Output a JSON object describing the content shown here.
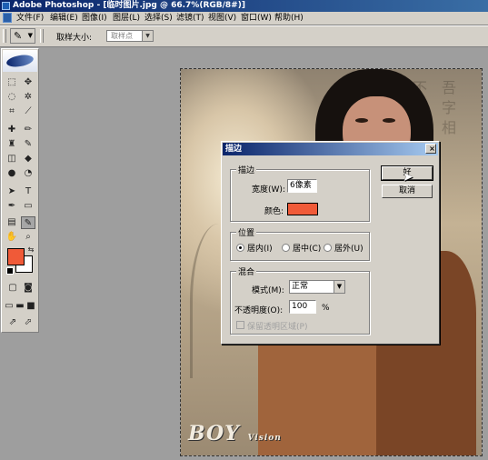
{
  "window": {
    "title": "Adobe Photoshop - [临时图片.jpg @ 66.7%(RGB/8#)]"
  },
  "menu": {
    "items": [
      "文件(F)",
      "编辑(E)",
      "图像(I)",
      "图层(L)",
      "选择(S)",
      "滤镜(T)",
      "视图(V)",
      "窗口(W)",
      "帮助(H)"
    ]
  },
  "options": {
    "sample_size_label": "取样大小:",
    "sample_size_value": "取样点"
  },
  "toolbox": {
    "foreground_color": "#f05a38",
    "background_color": "#ffffff"
  },
  "dialog": {
    "title": "描边",
    "close": "×",
    "stroke_group": "描边",
    "width_label": "宽度(W):",
    "width_value": "6像素",
    "color_label": "颜色:",
    "color_value": "#f05a38",
    "position_group": "位置",
    "positions": [
      "居内(I)",
      "居中(C)",
      "居外(U)"
    ],
    "selected_position": "居内(I)",
    "blend_group": "混合",
    "mode_label": "模式(M):",
    "mode_value": "正常",
    "opacity_label": "不透明度(O):",
    "opacity_value": "100",
    "opacity_unit": "%",
    "preserve_label": "保留透明区域(P)",
    "ok_label": "好",
    "cancel_label": "取消"
  },
  "canvas": {
    "logo_text": "BOY",
    "logo_sub": "Vision"
  }
}
